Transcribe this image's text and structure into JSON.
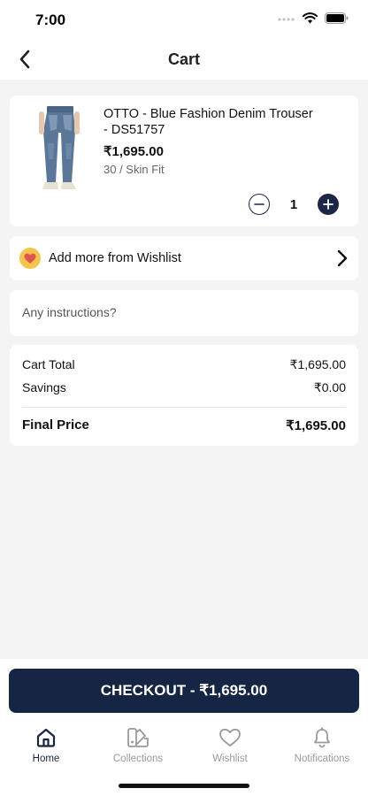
{
  "status_bar": {
    "time": "7:00"
  },
  "nav": {
    "title": "Cart"
  },
  "cart_item": {
    "name": "OTTO - Blue Fashion Denim Trouser - DS51757",
    "price": "₹1,695.00",
    "variant": "30 / Skin Fit",
    "quantity": "1"
  },
  "wishlist_row": {
    "label": "Add more from Wishlist"
  },
  "instructions": {
    "placeholder": "Any instructions?",
    "value": ""
  },
  "summary": {
    "cart_total_label": "Cart Total",
    "cart_total_value": "₹1,695.00",
    "savings_label": "Savings",
    "savings_value": "₹0.00",
    "final_label": "Final Price",
    "final_value": "₹1,695.00"
  },
  "checkout": {
    "label": "CHECKOUT - ₹1,695.00"
  },
  "tabs": [
    {
      "label": "Home",
      "icon": "home-icon",
      "active": true
    },
    {
      "label": "Collections",
      "icon": "collections-icon",
      "active": false
    },
    {
      "label": "Wishlist",
      "icon": "heart-icon",
      "active": false
    },
    {
      "label": "Notifications",
      "icon": "bell-icon",
      "active": false
    }
  ],
  "colors": {
    "primary": "#172544",
    "wishlist_badge": "#f3c64b",
    "heart": "#e25450",
    "inactive_tab": "#9a9a9a"
  }
}
